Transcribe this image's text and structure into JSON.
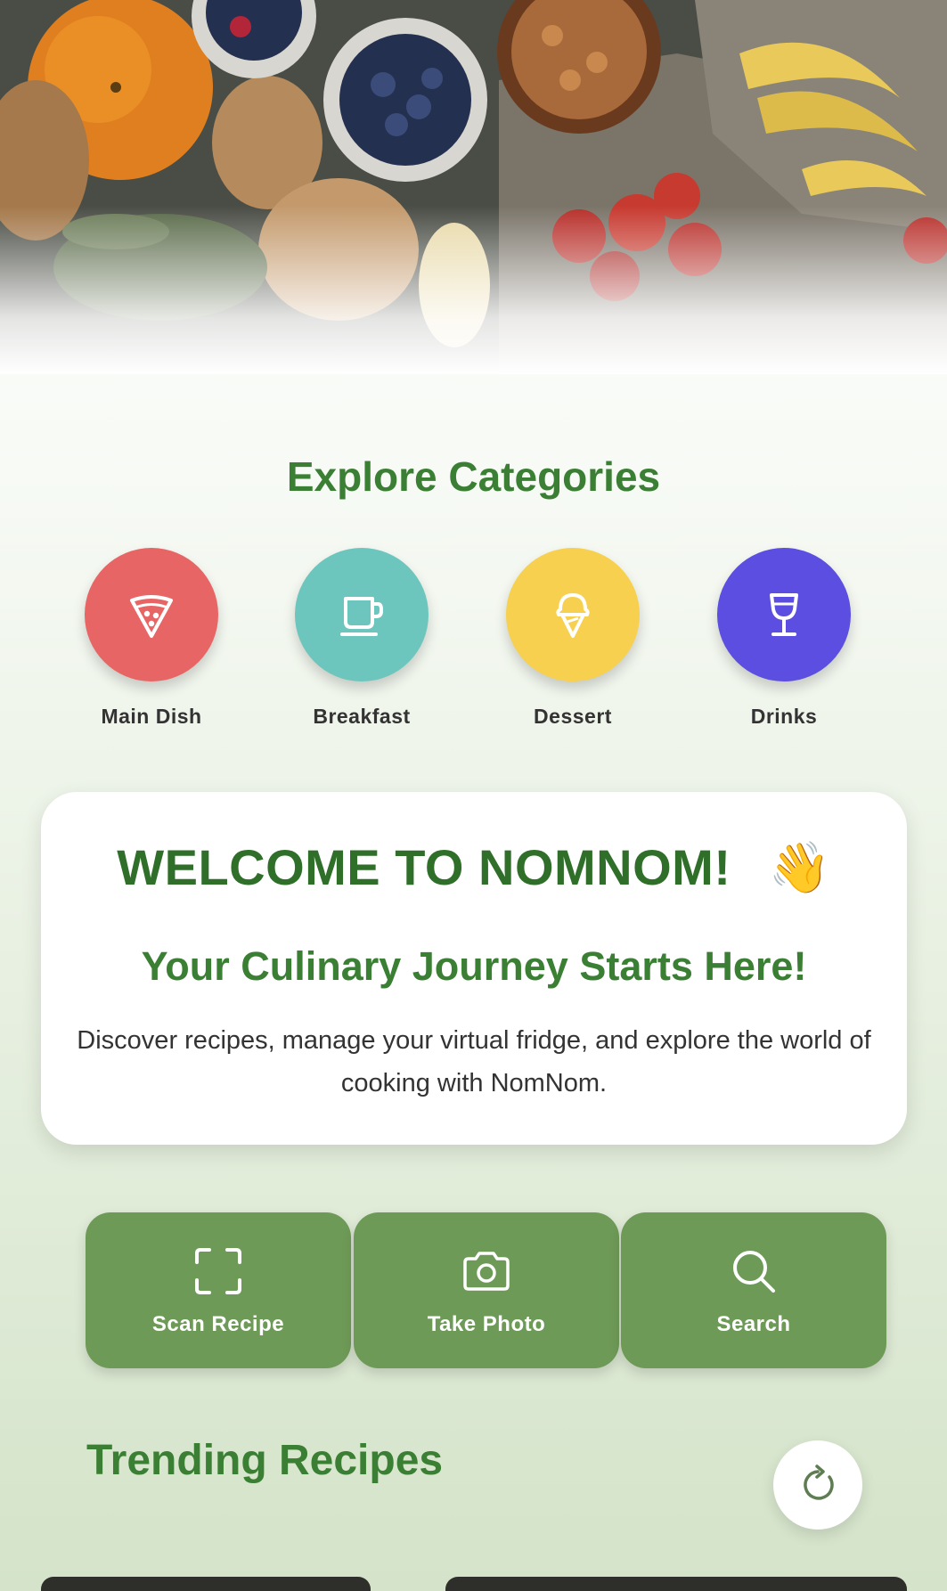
{
  "hero": {
    "image": "groceries-flatlay-photo"
  },
  "categories": {
    "title": "Explore Categories",
    "items": [
      {
        "label": "Main Dish",
        "icon": "pizza-slice-icon",
        "color": "#e86565"
      },
      {
        "label": "Breakfast",
        "icon": "coffee-cup-icon",
        "color": "#6cc6bd"
      },
      {
        "label": "Dessert",
        "icon": "ice-cream-icon",
        "color": "#f7d04f"
      },
      {
        "label": "Drinks",
        "icon": "wine-glass-icon",
        "color": "#5b4ee0"
      }
    ]
  },
  "welcome": {
    "title": "WELCOME TO NOMNOM!",
    "emoji": "👋",
    "subtitle": "Your Culinary Journey Starts Here!",
    "text": "Discover recipes, manage your virtual fridge, and explore the world of cooking with NomNom."
  },
  "actions": [
    {
      "label": "Scan Recipe",
      "icon": "scan-icon"
    },
    {
      "label": "Take Photo",
      "icon": "camera-icon"
    },
    {
      "label": "Search",
      "icon": "search-icon"
    }
  ],
  "trending": {
    "title": "Trending Recipes",
    "refresh_icon": "refresh-icon"
  },
  "colors": {
    "brand_green": "#3a7f33",
    "button_green": "#6e9a57"
  }
}
